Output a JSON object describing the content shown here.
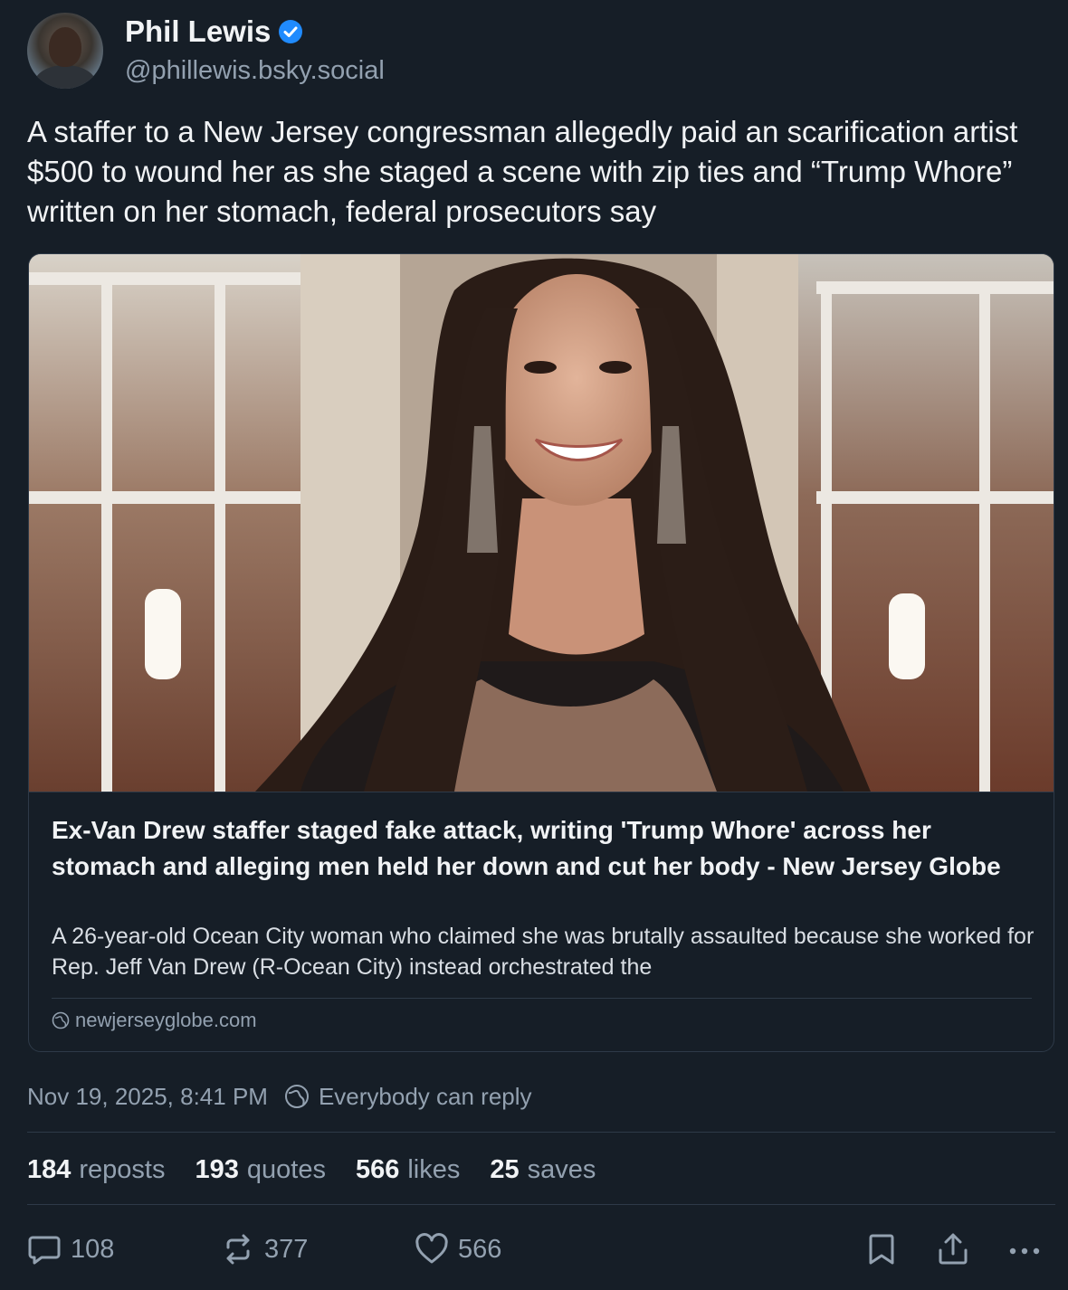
{
  "author": {
    "display_name": "Phil Lewis",
    "handle": "@phillewis.bsky.social",
    "verified": true
  },
  "post": {
    "text": "A staffer to a New Jersey congressman allegedly paid an scarification artist $500 to wound her as she staged a scene with zip ties and “Trump Whore” written on her stomach, federal prosecutors say"
  },
  "link_card": {
    "title": "Ex-Van Drew staffer staged fake attack, writing 'Trump Whore' across her stomach and alleging men held her down and cut her body - New Jersey Globe",
    "description": "A 26-year-old Ocean City woman who claimed she was brutally assaulted because she worked for Rep. Jeff Van Drew (R-Ocean City) instead orchestrated the",
    "domain": "newjerseyglobe.com",
    "domain_icon": "globe-icon"
  },
  "meta": {
    "timestamp": "Nov 19, 2025, 8:41 PM",
    "reply_setting": "Everybody can reply"
  },
  "stats": [
    {
      "count": "184",
      "label": "reposts"
    },
    {
      "count": "193",
      "label": "quotes"
    },
    {
      "count": "566",
      "label": "likes"
    },
    {
      "count": "25",
      "label": "saves"
    }
  ],
  "actions": {
    "reply_count": "108",
    "repost_count": "377",
    "like_count": "566"
  },
  "colors": {
    "background": "#161e27",
    "accent_verified": "#208bfe",
    "muted_text": "#93a1b0",
    "border": "#2e3a48"
  }
}
